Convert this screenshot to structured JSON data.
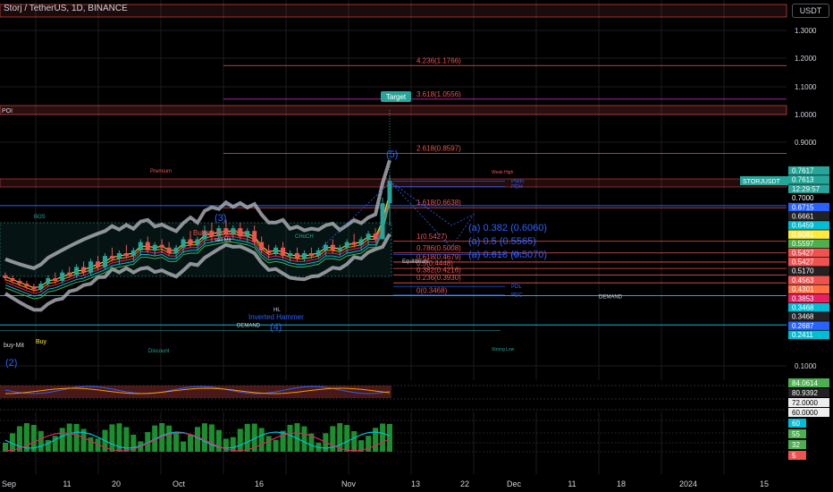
{
  "header": {
    "symbol": "Storj / TetherUS, 1D, BINANCE",
    "currency": "USDT"
  },
  "colors": {
    "bg": "#000000",
    "up": "#26a69a",
    "down": "#ef5350",
    "fib": "#ef5350",
    "grid": "#1c1c1c",
    "ema_band": "#b0b3ba"
  },
  "price_axis": {
    "ticks": [
      "1.3000",
      "1.2000",
      "1.1000",
      "1.0000",
      "0.9000",
      "0.1000"
    ],
    "labels": [
      {
        "v": "0.7617",
        "c": "#26a69a"
      },
      {
        "v": "0.7613",
        "c": "#26a69a"
      },
      {
        "v": "12:29:57",
        "c": "#26a69a"
      },
      {
        "v": "0.7000",
        "c": "#000"
      },
      {
        "v": "0.6715",
        "c": "#2962ff"
      },
      {
        "v": "0.6661",
        "c": "#222"
      },
      {
        "v": "0.6459",
        "c": "#00bcd4"
      },
      {
        "v": "0.6081",
        "c": "#ffeb3b"
      },
      {
        "v": "0.5597",
        "c": "#4caf50"
      },
      {
        "v": "0.5427",
        "c": "#ef5350"
      },
      {
        "v": "0.5427",
        "c": "#ef5350"
      },
      {
        "v": "0.5170",
        "c": "#222"
      },
      {
        "v": "0.4563",
        "c": "#ef5350"
      },
      {
        "v": "0.4301",
        "c": "#ff7043"
      },
      {
        "v": "0.3853",
        "c": "#e91e63"
      },
      {
        "v": "0.3468",
        "c": "#00bcd4"
      },
      {
        "v": "0.3468",
        "c": "#222"
      },
      {
        "v": "0.2687",
        "c": "#2962ff"
      },
      {
        "v": "0.2411",
        "c": "#00bcd4"
      }
    ],
    "symbol_tag": "STORJUSDT"
  },
  "osc_axis": {
    "a": [
      {
        "v": "84.0614",
        "c": "#4caf50"
      },
      {
        "v": "80.9392",
        "c": "#222"
      },
      {
        "v": "72.0000",
        "c": "#eee"
      },
      {
        "v": "60.0000",
        "c": "#eee"
      }
    ],
    "b": [
      {
        "v": "60",
        "c": "#00bcd4"
      },
      {
        "v": "55",
        "c": "#4caf50"
      },
      {
        "v": "32",
        "c": "#4caf50"
      },
      {
        "v": "5",
        "c": "#ef5350"
      }
    ]
  },
  "time_axis": [
    "Sep",
    "11",
    "20",
    "Oct",
    "16",
    "Nov",
    "13",
    "22",
    "Dec",
    "11",
    "18",
    "2024",
    "15"
  ],
  "fib_levels": [
    {
      "label": "4.236(1.1766)",
      "price": 1.1766
    },
    {
      "label": "3.618(1.0556)",
      "price": 1.0556
    },
    {
      "label": "2.618(0.8597)",
      "price": 0.8597
    },
    {
      "label": "1.618(0.6638)",
      "price": 0.6638
    },
    {
      "label": "1(0.5427)",
      "price": 0.5427
    },
    {
      "label": "0.786(0.5008)",
      "price": 0.5008
    },
    {
      "label": "0.618(0.4679)",
      "price": 0.4679
    },
    {
      "label": "0.5(0.4448)",
      "price": 0.4448
    },
    {
      "label": "0.382(0.4216)",
      "price": 0.4216
    },
    {
      "label": "0.236(0.3930)",
      "price": 0.393
    },
    {
      "label": "0(0.3468)",
      "price": 0.3468
    }
  ],
  "retrace_labels": [
    "(a) 0.382 (0.6060)",
    "(a) 0.5 (0.5565)",
    "(a) 0.618 (0.5070)"
  ],
  "annotations": {
    "target": "Target",
    "poi": "POI",
    "premium": "Premium",
    "discount": "Discount",
    "bos": "BOS",
    "choch": "CHoCH",
    "bullish_engulfing": "Bullish Engulfing",
    "sell_mit": "sell Mit",
    "inverted_hammer": "Inverted Hammer",
    "hl": "HL",
    "equilibrium": "Equilibrium",
    "demand": "DEMAND",
    "weak_high": "Weak High",
    "strong_low": "Strong Low",
    "pwh": "PWH",
    "pdh": "PDH",
    "pdl": "PDL",
    "pwl": "PWL",
    "pdc": "PDC",
    "buy_mit": "buy-Mit",
    "buy": "Buy",
    "wave_2": "(2)",
    "wave_3": "(3)",
    "wave_4": "(4)",
    "wave_5": "(5)"
  },
  "chart_data": {
    "type": "candlestick",
    "title": "Storj / TetherUS, 1D, BINANCE",
    "y_scale": "log",
    "ylim": [
      0.09,
      1.35
    ],
    "x": [
      "Sep",
      "11",
      "20",
      "Oct",
      "16",
      "Nov",
      "13",
      "22",
      "Dec",
      "11",
      "18",
      "2024",
      "15"
    ],
    "candles": [
      [
        0.42,
        0.43,
        0.4,
        0.41
      ],
      [
        0.41,
        0.42,
        0.39,
        0.4
      ],
      [
        0.4,
        0.41,
        0.38,
        0.39
      ],
      [
        0.39,
        0.4,
        0.37,
        0.38
      ],
      [
        0.38,
        0.39,
        0.36,
        0.37
      ],
      [
        0.37,
        0.4,
        0.36,
        0.39
      ],
      [
        0.39,
        0.42,
        0.38,
        0.41
      ],
      [
        0.41,
        0.43,
        0.39,
        0.4
      ],
      [
        0.4,
        0.44,
        0.39,
        0.43
      ],
      [
        0.43,
        0.45,
        0.41,
        0.42
      ],
      [
        0.42,
        0.46,
        0.41,
        0.45
      ],
      [
        0.45,
        0.47,
        0.42,
        0.43
      ],
      [
        0.43,
        0.48,
        0.42,
        0.47
      ],
      [
        0.47,
        0.49,
        0.44,
        0.45
      ],
      [
        0.45,
        0.5,
        0.44,
        0.49
      ],
      [
        0.49,
        0.52,
        0.47,
        0.48
      ],
      [
        0.48,
        0.51,
        0.46,
        0.5
      ],
      [
        0.5,
        0.53,
        0.48,
        0.49
      ],
      [
        0.49,
        0.52,
        0.47,
        0.51
      ],
      [
        0.51,
        0.55,
        0.49,
        0.54
      ],
      [
        0.54,
        0.56,
        0.5,
        0.51
      ],
      [
        0.51,
        0.54,
        0.49,
        0.53
      ],
      [
        0.53,
        0.55,
        0.5,
        0.52
      ],
      [
        0.52,
        0.54,
        0.49,
        0.5
      ],
      [
        0.5,
        0.53,
        0.48,
        0.52
      ],
      [
        0.52,
        0.56,
        0.5,
        0.55
      ],
      [
        0.55,
        0.58,
        0.52,
        0.53
      ],
      [
        0.53,
        0.56,
        0.51,
        0.55
      ],
      [
        0.55,
        0.6,
        0.53,
        0.58
      ],
      [
        0.58,
        0.61,
        0.54,
        0.56
      ],
      [
        0.56,
        0.6,
        0.55,
        0.59
      ],
      [
        0.59,
        0.62,
        0.56,
        0.57
      ],
      [
        0.57,
        0.6,
        0.55,
        0.59
      ],
      [
        0.59,
        0.61,
        0.55,
        0.56
      ],
      [
        0.56,
        0.59,
        0.54,
        0.58
      ],
      [
        0.58,
        0.6,
        0.53,
        0.54
      ],
      [
        0.54,
        0.56,
        0.5,
        0.51
      ],
      [
        0.51,
        0.53,
        0.48,
        0.5
      ],
      [
        0.5,
        0.53,
        0.49,
        0.52
      ],
      [
        0.52,
        0.54,
        0.48,
        0.49
      ],
      [
        0.49,
        0.51,
        0.47,
        0.5
      ],
      [
        0.5,
        0.52,
        0.47,
        0.48
      ],
      [
        0.48,
        0.51,
        0.47,
        0.5
      ],
      [
        0.5,
        0.52,
        0.48,
        0.49
      ],
      [
        0.49,
        0.52,
        0.48,
        0.51
      ],
      [
        0.51,
        0.54,
        0.49,
        0.53
      ],
      [
        0.53,
        0.55,
        0.5,
        0.51
      ],
      [
        0.51,
        0.53,
        0.49,
        0.52
      ],
      [
        0.52,
        0.55,
        0.5,
        0.54
      ],
      [
        0.54,
        0.57,
        0.52,
        0.53
      ],
      [
        0.53,
        0.56,
        0.51,
        0.55
      ],
      [
        0.55,
        0.58,
        0.53,
        0.57
      ],
      [
        0.57,
        0.59,
        0.54,
        0.55
      ],
      [
        0.55,
        0.7,
        0.55,
        0.68
      ],
      [
        0.68,
        0.78,
        0.6,
        0.7613
      ]
    ]
  }
}
